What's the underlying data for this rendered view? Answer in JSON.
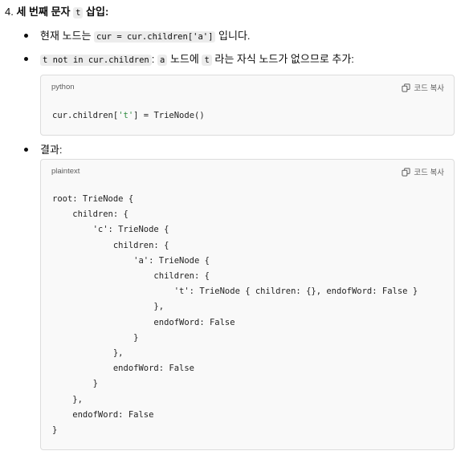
{
  "step": {
    "number": "4.",
    "title_pre": "세 번째 문자 ",
    "title_code": "t",
    "title_post": " 삽입:"
  },
  "bullets": [
    {
      "pre": "현재 노드는 ",
      "code": "cur = cur.children['a']",
      "post": " 입니다."
    },
    {
      "code1": "t not in cur.children",
      "colon": ": ",
      "code2": "a",
      "mid": " 노드에 ",
      "code3": "t",
      "post": " 라는 자식 노드가 없으므로 추가:"
    },
    {
      "text": "결과:"
    }
  ],
  "code_blocks": [
    {
      "language": "python",
      "copy_label": "코드 복사",
      "code_pre": "cur.children[",
      "code_str": "'t'",
      "code_post": "] = TrieNode()"
    },
    {
      "language": "plaintext",
      "copy_label": "코드 복사",
      "code": "root: TrieNode {\n    children: {\n        'c': TrieNode {\n            children: {\n                'a': TrieNode {\n                    children: {\n                        't': TrieNode { children: {}, endofWord: False }\n                    },\n                    endofWord: False\n                }\n            },\n            endofWord: False\n        }\n    },\n    endofWord: False\n}"
    }
  ]
}
